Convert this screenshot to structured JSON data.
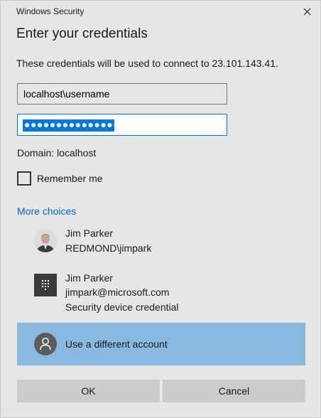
{
  "window": {
    "title": "Windows Security"
  },
  "heading": "Enter your credentials",
  "description": "These credentials will be used to connect to 23.101.143.41.",
  "username": {
    "value": "localhost\\username"
  },
  "password": {
    "masked": "●●●●●●●●●●●●●●●"
  },
  "domain": "Domain: localhost",
  "remember": {
    "label": "Remember me",
    "checked": false
  },
  "more_choices": "More choices",
  "accounts": [
    {
      "name": "Jim Parker",
      "detail": "REDMOND\\jimpark",
      "icon": "user-photo-icon"
    },
    {
      "name": "Jim Parker",
      "detail": "jimpark@microsoft.com",
      "detail2": "Security device credential",
      "icon": "security-device-icon"
    },
    {
      "name": "Use a different account",
      "icon": "generic-user-icon",
      "selected": true
    }
  ],
  "buttons": {
    "ok": "OK",
    "cancel": "Cancel"
  },
  "colors": {
    "accent": "#0078d7",
    "link": "#0066cc",
    "selected_row": "#8ab9e0",
    "background": "#e6e6e6"
  }
}
